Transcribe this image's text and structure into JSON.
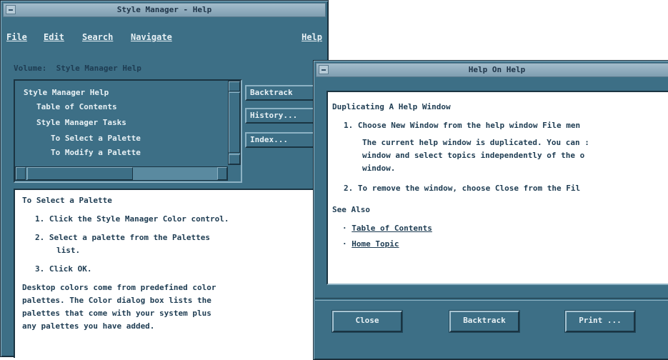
{
  "style_window": {
    "title": "Style Manager - Help",
    "menu": {
      "file": "File",
      "edit": "Edit",
      "search": "Search",
      "navigate": "Navigate",
      "help": "Help"
    },
    "volume_label": "Volume:",
    "volume_name": "Style Manager Help",
    "topics": [
      "Style Manager Help",
      "Table of Contents",
      "Style Manager Tasks",
      "To Select a Palette",
      "To Modify a Palette"
    ],
    "buttons": {
      "backtrack": "Backtrack",
      "history": "History...",
      "index": "Index..."
    },
    "content": {
      "heading": "To Select a Palette",
      "step1": "1. Click the Style Manager Color control.",
      "step2a": "2. Select a palette from the Palettes",
      "step2b": "list.",
      "step3": "3. Click OK.",
      "para": [
        "Desktop colors come from predefined color",
        "palettes. The Color dialog box lists the",
        "palettes that come with your system plus",
        "any palettes you have added."
      ]
    }
  },
  "help_window": {
    "title": "Help On Help",
    "heading": "Duplicating A Help Window",
    "step1": "1. Choose New Window from the help window File men",
    "step1_detail": [
      "The current help window is duplicated. You can :",
      "window and select topics independently of the o",
      "window."
    ],
    "step2": "2. To remove the window, choose Close from the Fil",
    "see_also": "See Also",
    "links": [
      "Table of Contents",
      "Home Topic"
    ],
    "buttons": {
      "close": "Close",
      "backtrack": "Backtrack",
      "print": "Print ..."
    }
  },
  "colors": {
    "window_bg": "#3d6f86",
    "title_bg": "#8fa9b9",
    "text": "#1e3c52",
    "content_bg": "#ffffff"
  }
}
